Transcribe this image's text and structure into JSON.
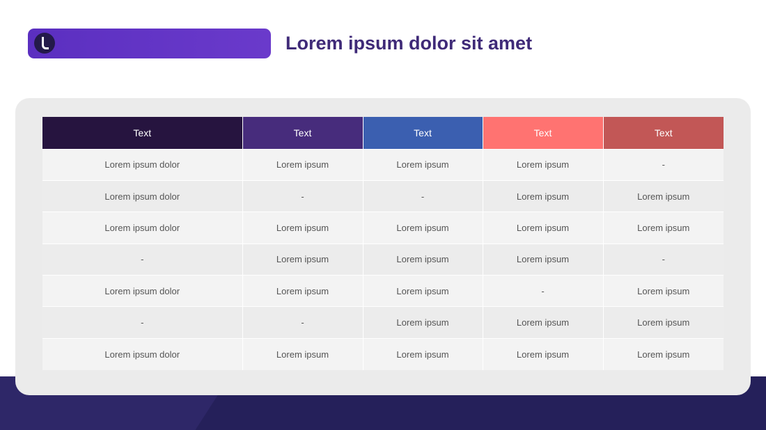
{
  "slide": {
    "title": "Lorem ipsum dolor sit amet"
  },
  "brand": {
    "icon": "brand-logo-icon",
    "bar_color": "#6a3acb"
  },
  "table": {
    "headers": [
      {
        "label": "Text",
        "color": "#26143f"
      },
      {
        "label": "Text",
        "color": "#472c7c"
      },
      {
        "label": "Text",
        "color": "#3b5fb0"
      },
      {
        "label": "Text",
        "color": "#ff7371"
      },
      {
        "label": "Text",
        "color": "#c25756"
      }
    ],
    "rows": [
      [
        "Lorem ipsum dolor",
        "Lorem ipsum",
        "Lorem ipsum",
        "Lorem ipsum",
        "-"
      ],
      [
        "Lorem ipsum dolor",
        "-",
        "-",
        "Lorem ipsum",
        "Lorem ipsum"
      ],
      [
        "Lorem ipsum dolor",
        "Lorem ipsum",
        "Lorem ipsum",
        "Lorem ipsum",
        "Lorem ipsum"
      ],
      [
        "-",
        "Lorem ipsum",
        "Lorem ipsum",
        "Lorem ipsum",
        "-"
      ],
      [
        "Lorem ipsum dolor",
        "Lorem ipsum",
        "Lorem ipsum",
        "-",
        "Lorem ipsum"
      ],
      [
        "-",
        "-",
        "Lorem ipsum",
        "Lorem ipsum",
        "Lorem ipsum"
      ],
      [
        "Lorem ipsum dolor",
        "Lorem ipsum",
        "Lorem ipsum",
        "Lorem ipsum",
        "Lorem ipsum"
      ]
    ]
  },
  "colors": {
    "title": "#3f2a78",
    "footer": "#25205a",
    "panel": "#ebebeb"
  }
}
